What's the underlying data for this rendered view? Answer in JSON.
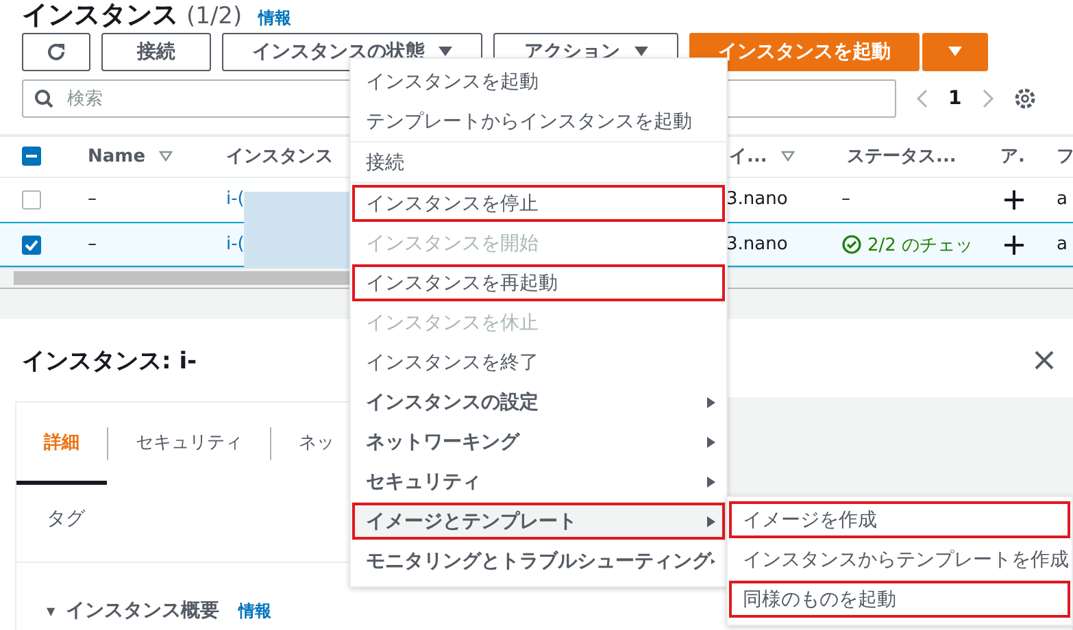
{
  "header": {
    "title": "インスタンス",
    "count": "(1/2)",
    "info_link": "情報"
  },
  "toolbar": {
    "connect": "接続",
    "state_button": "インスタンスの状態",
    "actions_button": "アクション",
    "launch_button": "インスタンスを起動"
  },
  "search": {
    "placeholder": "検索"
  },
  "pagination": {
    "page": "1"
  },
  "table": {
    "all_indeterminate": true,
    "columns": [
      "Name",
      "インスタンス",
      "イ...",
      "ステータス...",
      "ア.",
      "フ"
    ],
    "rows": [
      {
        "checked": false,
        "selected": false,
        "name": "–",
        "instance": "i-(",
        "type": "3.nano",
        "status": "–",
        "status_ok": false,
        "column_6": "a"
      },
      {
        "checked": true,
        "selected": true,
        "name": "–",
        "instance": "i-(",
        "type": "3.nano",
        "status": "2/2 のチェッ",
        "status_ok": true,
        "column_6": "a"
      }
    ]
  },
  "details": {
    "title": "インスタンス: i-",
    "tabs": [
      {
        "label": "詳細",
        "selected": true
      },
      {
        "label": "セキュリティ",
        "selected": false
      },
      {
        "label": "ネッ",
        "selected": false
      }
    ],
    "tag_tab": "タグ",
    "collapse_glyph": "▼",
    "section": "インスタンス概要",
    "section_info": "情報"
  },
  "menu": [
    {
      "kind": "item",
      "label": "インスタンスを起動",
      "disabled": false,
      "bold": false,
      "submenu": false,
      "highlighted": false,
      "hovered": false
    },
    {
      "kind": "item",
      "label": "テンプレートからインスタンスを起動",
      "disabled": false,
      "bold": false,
      "submenu": false,
      "highlighted": false,
      "hovered": false
    },
    {
      "kind": "divider"
    },
    {
      "kind": "item",
      "label": "接続",
      "disabled": false,
      "bold": false,
      "submenu": false,
      "highlighted": false,
      "hovered": false
    },
    {
      "kind": "divider"
    },
    {
      "kind": "item",
      "label": "インスタンスを停止",
      "disabled": false,
      "bold": false,
      "submenu": false,
      "highlighted": true,
      "hovered": false
    },
    {
      "kind": "item",
      "label": "インスタンスを開始",
      "disabled": true,
      "bold": false,
      "submenu": false,
      "highlighted": false,
      "hovered": false
    },
    {
      "kind": "item",
      "label": "インスタンスを再起動",
      "disabled": false,
      "bold": false,
      "submenu": false,
      "highlighted": true,
      "hovered": false
    },
    {
      "kind": "item",
      "label": "インスタンスを休止",
      "disabled": true,
      "bold": false,
      "submenu": false,
      "highlighted": false,
      "hovered": false
    },
    {
      "kind": "item",
      "label": "インスタンスを終了",
      "disabled": false,
      "bold": false,
      "submenu": false,
      "highlighted": false,
      "hovered": false
    },
    {
      "kind": "item",
      "label": "インスタンスの設定",
      "disabled": false,
      "bold": true,
      "submenu": true,
      "highlighted": false,
      "hovered": false
    },
    {
      "kind": "item",
      "label": "ネットワーキング",
      "disabled": false,
      "bold": true,
      "submenu": true,
      "highlighted": false,
      "hovered": false
    },
    {
      "kind": "item",
      "label": "セキュリティ",
      "disabled": false,
      "bold": true,
      "submenu": true,
      "highlighted": false,
      "hovered": false
    },
    {
      "kind": "item",
      "label": "イメージとテンプレート",
      "disabled": false,
      "bold": true,
      "submenu": true,
      "highlighted": true,
      "hovered": true
    },
    {
      "kind": "item",
      "label": "モニタリングとトラブルシューティング",
      "disabled": false,
      "bold": true,
      "submenu": true,
      "highlighted": false,
      "hovered": false
    }
  ],
  "submenu": [
    {
      "label": "イメージを作成",
      "highlighted": true
    },
    {
      "label": "インスタンスからテンプレートを作成",
      "highlighted": false
    },
    {
      "label": "同様のものを起動",
      "highlighted": true
    }
  ]
}
